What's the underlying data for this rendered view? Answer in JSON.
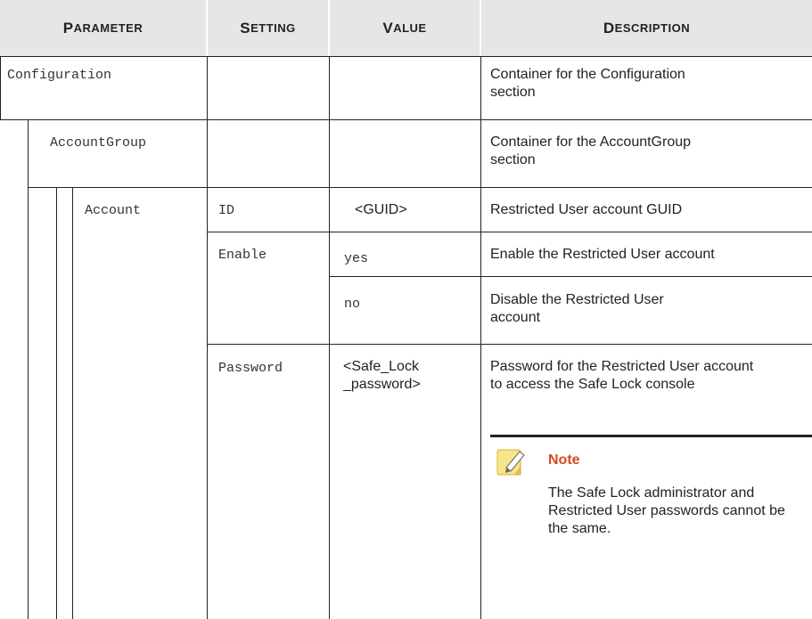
{
  "table": {
    "headers": [
      {
        "cap": "P",
        "rest": "ARAMETER"
      },
      {
        "cap": "S",
        "rest": "ETTING"
      },
      {
        "cap": "V",
        "rest": "ALUE"
      },
      {
        "cap": "D",
        "rest": "ESCRIPTION"
      }
    ],
    "rows": {
      "configuration": {
        "parameter": "Configuration",
        "description": "Container for the Configuration section"
      },
      "accountgroup": {
        "parameter": "AccountGroup",
        "description": "Container for the AccountGroup section"
      },
      "account": {
        "parameter": "Account"
      },
      "id": {
        "setting": "ID",
        "value": "<GUID>",
        "description": "Restricted User account GUID"
      },
      "enable": {
        "setting": "Enable"
      },
      "enable_yes": {
        "value": "yes",
        "description": "Enable the Restricted User account"
      },
      "enable_no": {
        "value": "no",
        "description": "Disable the Restricted User account"
      },
      "password": {
        "setting": "Password",
        "value": "<Safe_Lock _password>",
        "description": "Password for the Restricted User account to access the Safe Lock console"
      }
    }
  },
  "note": {
    "title": "Note",
    "text": "The Safe Lock administrator and Restricted User passwords cannot be the same.",
    "icon": "note-pencil-icon",
    "title_color": "#d44a1c"
  }
}
